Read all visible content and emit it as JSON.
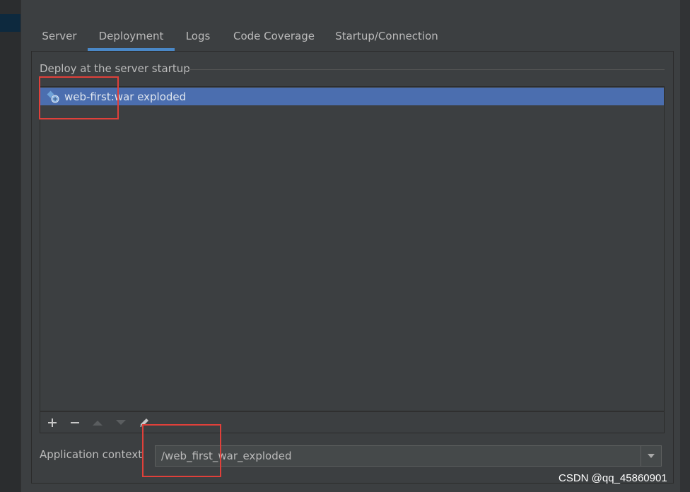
{
  "tabs": [
    {
      "label": "Server"
    },
    {
      "label": "Deployment",
      "active": true
    },
    {
      "label": "Logs"
    },
    {
      "label": "Code Coverage"
    },
    {
      "label": "Startup/Connection"
    }
  ],
  "deploy": {
    "title": "Deploy at the server startup",
    "items": [
      {
        "label": "web-first:war exploded",
        "icon": "artifact-exploded-icon",
        "selected": true
      }
    ]
  },
  "toolbar": {
    "buttons": [
      {
        "name": "add-icon"
      },
      {
        "name": "remove-icon"
      },
      {
        "name": "move-up-icon"
      },
      {
        "name": "move-down-icon"
      },
      {
        "name": "edit-icon"
      }
    ]
  },
  "context": {
    "label": "Application context",
    "value": "/web_first_war_exploded"
  },
  "watermark": "CSDN @qq_45860901",
  "colors": {
    "background": "#3c3f41",
    "selection": "#4b6eaf",
    "tab_underline": "#4a88c7",
    "highlight_box": "#e0403a"
  }
}
